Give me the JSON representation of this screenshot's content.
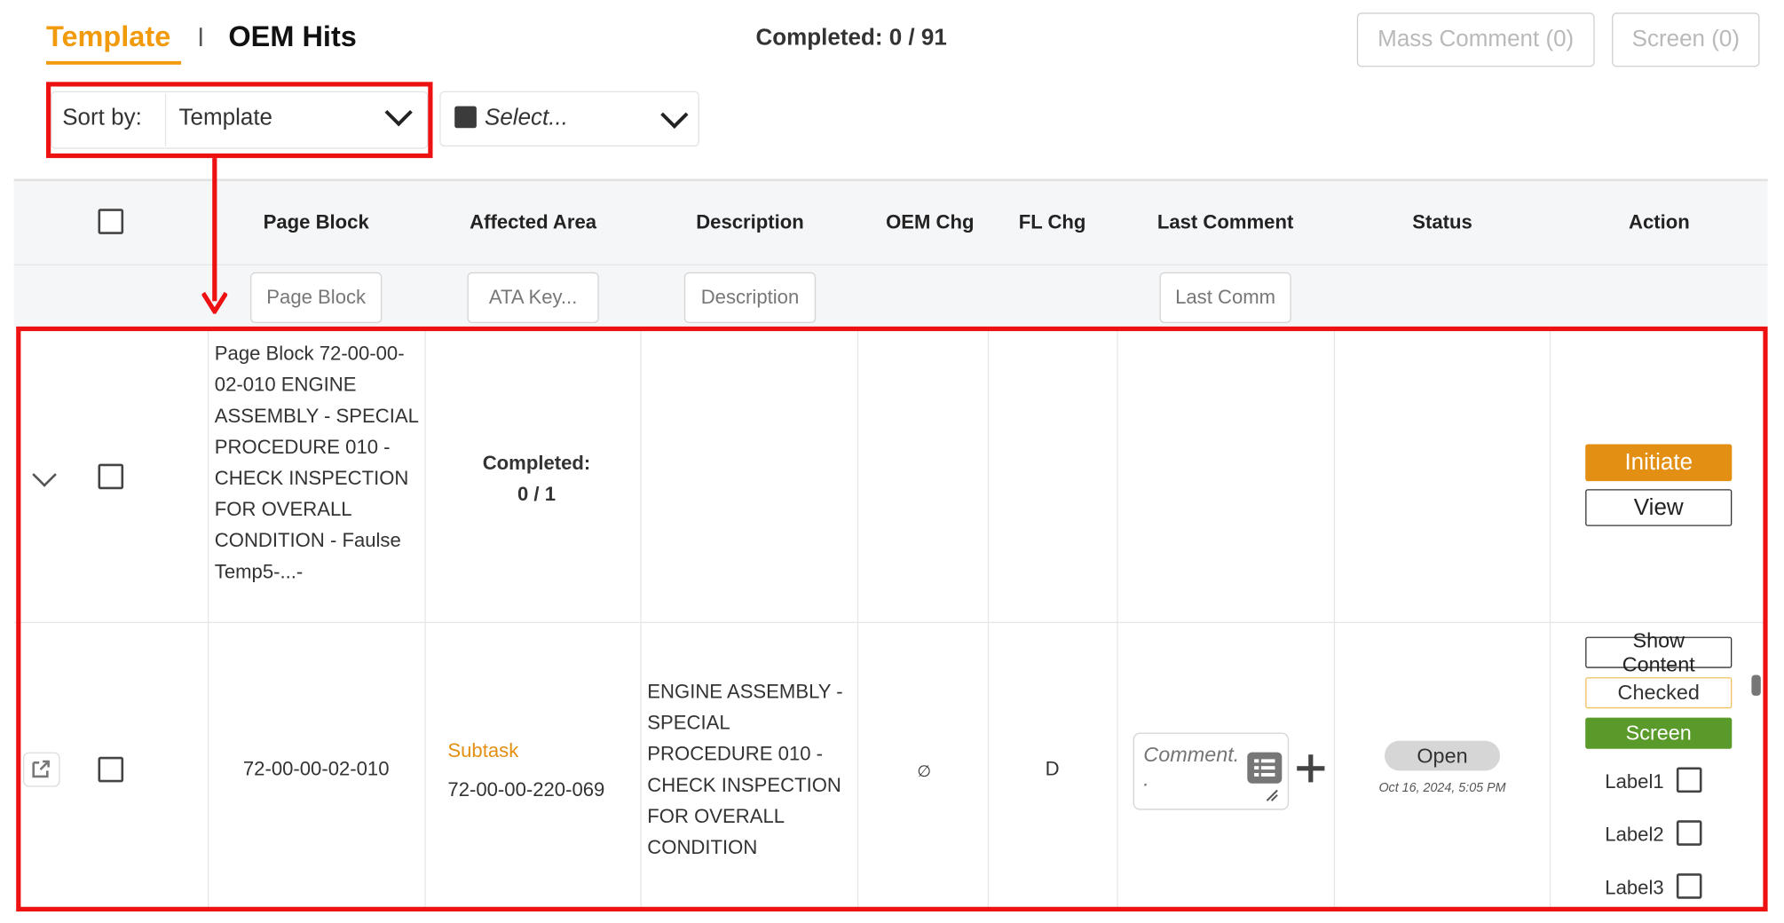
{
  "header": {
    "tab_template": "Template",
    "tab_oem": "OEM Hits",
    "completed": "Completed: 0 / 91",
    "mass_comment": "Mass Comment (0)",
    "screen": "Screen (0)"
  },
  "sort": {
    "label": "Sort by:",
    "value": "Template",
    "select_placeholder": "Select..."
  },
  "table": {
    "columns": [
      "Page Block",
      "Affected Area",
      "Description",
      "OEM Chg",
      "FL Chg",
      "Last Comment",
      "Status",
      "Action"
    ],
    "filters": {
      "page_block": "Page Block",
      "affected_area": "ATA Key...",
      "description": "Description",
      "last_comment": "Last Comm"
    }
  },
  "group_row": {
    "page_block": "Page Block 72-00-00-02-010 ENGINE ASSEMBLY - SPECIAL PROCEDURE 010 - CHECK INSPECTION FOR OVERALL CONDITION - Faulse Temp5-...-",
    "completed_label": "Completed:",
    "completed_value": "0 / 1",
    "initiate": "Initiate",
    "view": "View"
  },
  "task_row": {
    "page_block": "72-00-00-02-010",
    "subtask_label": "Subtask",
    "subtask_value": "72-00-00-220-069",
    "description": "ENGINE ASSEMBLY - SPECIAL PROCEDURE 010 - CHECK INSPECTION FOR OVERALL CONDITION",
    "oem_chg": "∅",
    "fl_chg": "D",
    "comment_placeholder": "Comment..",
    "status": "Open",
    "status_date": "Oct 16, 2024, 5:05 PM",
    "show_content": "Show Content",
    "checked": "Checked",
    "screen": "Screen",
    "labels": [
      "Label1",
      "Label2",
      "Label3"
    ]
  },
  "colors": {
    "accent": "#f09a0c",
    "initiate": "#e38f14",
    "screen": "#5a9a2b",
    "highlight": "#ee1111"
  }
}
